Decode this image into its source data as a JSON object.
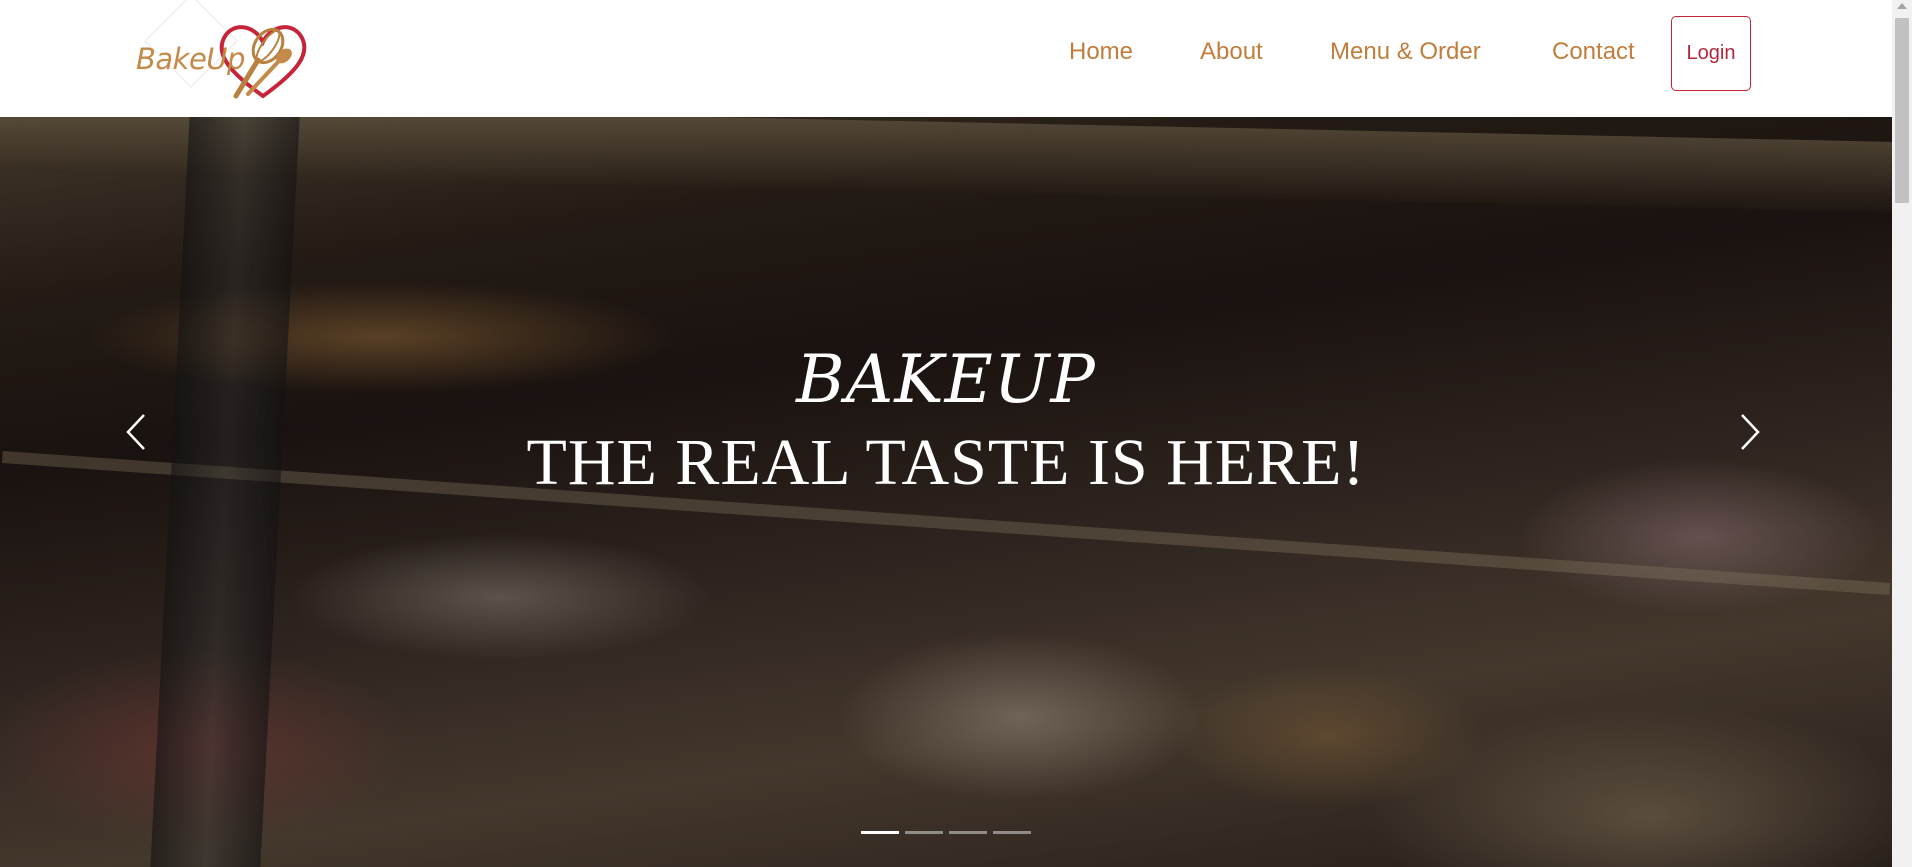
{
  "brand": {
    "name": "BakeUp",
    "colors": {
      "text": "#c48a4a",
      "heart": "#c7243a",
      "whisk": "#b8813f"
    }
  },
  "nav": {
    "items": [
      {
        "label": "Home"
      },
      {
        "label": "About"
      },
      {
        "label": "Menu & Order"
      },
      {
        "label": "Contact"
      }
    ],
    "login_label": "Login",
    "colors": {
      "link": "#c07d3c",
      "login": "#b3283d"
    }
  },
  "hero": {
    "title": "BAKEUP",
    "subtitle": "THE REAL TASTE IS HERE!",
    "slides_total": 4,
    "active_slide": 1,
    "icons": {
      "prev": "chevron-left-icon",
      "next": "chevron-right-icon"
    }
  }
}
